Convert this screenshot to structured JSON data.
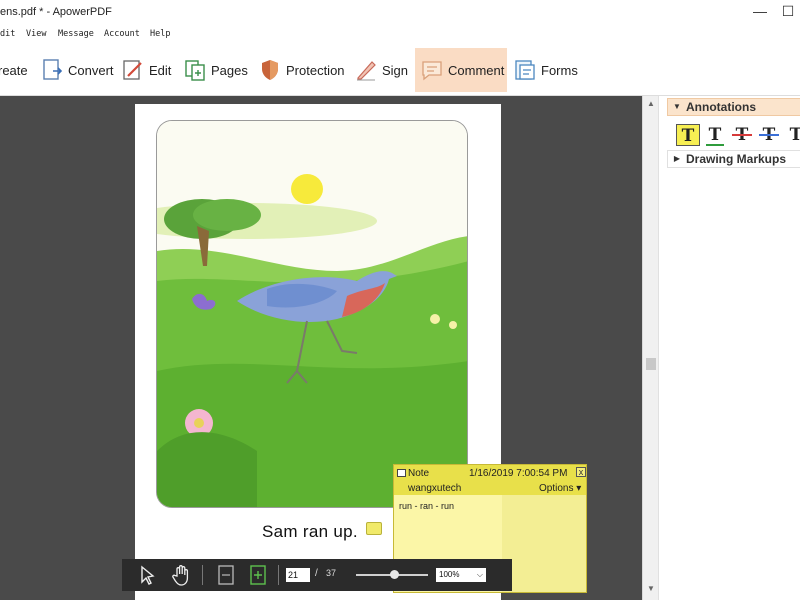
{
  "window": {
    "title": "ens.pdf * - ApowerPDF",
    "minimize": "—",
    "maximize": "☐"
  },
  "menu": [
    "dit",
    "View",
    "Message",
    "Account",
    "Help"
  ],
  "ribbon": [
    {
      "label": "reate",
      "icon": "create-icon"
    },
    {
      "label": "Convert",
      "icon": "convert-icon"
    },
    {
      "label": "Edit",
      "icon": "edit-icon"
    },
    {
      "label": "Pages",
      "icon": "pages-icon"
    },
    {
      "label": "Protection",
      "icon": "shield-icon"
    },
    {
      "label": "Sign",
      "icon": "pen-icon"
    },
    {
      "label": "Comment",
      "icon": "comment-icon",
      "active": true
    },
    {
      "label": "Forms",
      "icon": "forms-icon"
    }
  ],
  "document": {
    "caption": "Sam ran up."
  },
  "panel": {
    "annotations": "Annotations",
    "drawing_markups": "Drawing Markups",
    "tools": [
      "T",
      "T",
      "T",
      "T",
      "T"
    ]
  },
  "note": {
    "label": "Note",
    "date": "1/16/2019 7:00:54 PM",
    "close": "x",
    "author": "wangxutech",
    "options": "Options",
    "options_arrow": "▾",
    "text": "run - ran - run"
  },
  "floatbar": {
    "page": "21",
    "slash": "/",
    "total": "37",
    "zoom": "100%",
    "zoom_arrow": "⌵"
  },
  "colors": {
    "active_tab": "#fadcc4",
    "note_yellow": "#f8f06e",
    "highlight": "#f7ef53"
  }
}
